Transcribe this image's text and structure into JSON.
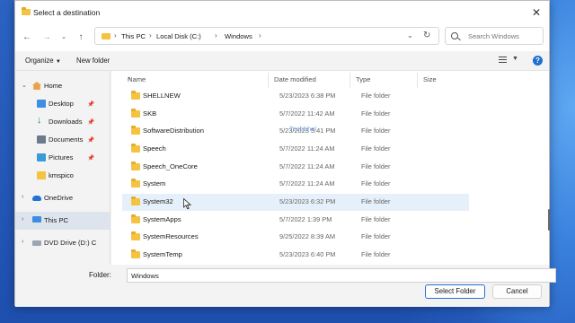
{
  "window": {
    "title": "Select a destination"
  },
  "address": {
    "crumbs": [
      "This PC",
      "Local Disk (C:)",
      "Windows"
    ],
    "search_placeholder": "Search Windows"
  },
  "toolbar": {
    "organize": "Organize",
    "new_folder": "New folder"
  },
  "sidebar": {
    "items": [
      {
        "label": "Home"
      },
      {
        "label": "Desktop"
      },
      {
        "label": "Downloads"
      },
      {
        "label": "Documents"
      },
      {
        "label": "Pictures"
      },
      {
        "label": "kmspico"
      },
      {
        "label": "OneDrive"
      },
      {
        "label": "This PC"
      },
      {
        "label": "DVD Drive (D:) C"
      }
    ]
  },
  "columns": {
    "name": "Name",
    "date": "Date modified",
    "type": "Type",
    "size": "Size"
  },
  "rows": [
    {
      "name": "SHELLNEW",
      "date": "5/23/2023 6:38 PM",
      "type": "File folder"
    },
    {
      "name": "SKB",
      "date": "5/7/2022 11:42 AM",
      "type": "File folder"
    },
    {
      "name": "SoftwareDistribution",
      "date": "5/23/2023 5:41 PM",
      "type": "File folder"
    },
    {
      "name": "Speech",
      "date": "5/7/2022 11:24 AM",
      "type": "File folder"
    },
    {
      "name": "Speech_OneCore",
      "date": "5/7/2022 11:24 AM",
      "type": "File folder"
    },
    {
      "name": "System",
      "date": "5/7/2022 11:24 AM",
      "type": "File folder"
    },
    {
      "name": "System32",
      "date": "5/23/2023 6:32 PM",
      "type": "File folder"
    },
    {
      "name": "SystemApps",
      "date": "5/7/2022 1:39 PM",
      "type": "File folder"
    },
    {
      "name": "SystemResources",
      "date": "9/25/2022 8:39 AM",
      "type": "File folder"
    },
    {
      "name": "SystemTemp",
      "date": "5/23/2023 6:40 PM",
      "type": "File folder"
    }
  ],
  "watermark": "Techbhal",
  "footer": {
    "folder_label": "Folder:",
    "folder_value": "Windows",
    "select_button": "Select Folder",
    "cancel_button": "Cancel"
  }
}
